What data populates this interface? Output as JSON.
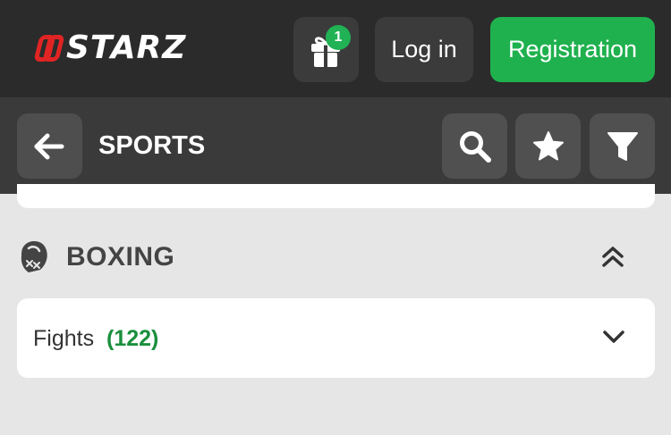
{
  "header": {
    "logo_text": "STARZ",
    "gift_badge": "1",
    "login_label": "Log in",
    "registration_label": "Registration"
  },
  "subheader": {
    "title": "SPORTS"
  },
  "sport": {
    "name": "BOXING",
    "category": {
      "label": "Fights",
      "count": "(122)"
    }
  },
  "icons": {
    "gift": "gift-icon",
    "back": "arrow-left-icon",
    "search": "search-icon",
    "favorites": "star-icon",
    "filter": "filter-icon",
    "sport": "boxing-glove-icon",
    "collapse": "double-chevron-up-icon",
    "expand": "chevron-down-icon"
  },
  "colors": {
    "topbar": "#2b2b2b",
    "subbar": "#3a3a3a",
    "accent_green": "#1fb14e",
    "count_green": "#1a8f3d",
    "logo_red": "#e02424",
    "background": "#e6e6e6"
  }
}
